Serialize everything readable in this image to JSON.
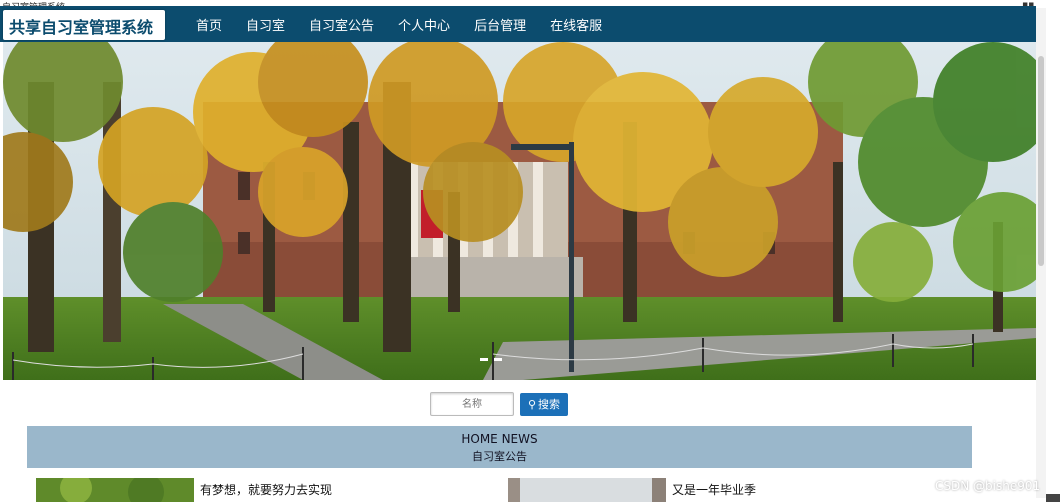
{
  "page_title": "自习室管理系统",
  "logo": "共享自习室管理系统",
  "nav": [
    {
      "label": "首页"
    },
    {
      "label": "自习室"
    },
    {
      "label": "自习室公告"
    },
    {
      "label": "个人中心"
    },
    {
      "label": "后台管理"
    },
    {
      "label": "在线客服"
    }
  ],
  "search": {
    "placeholder": "名称",
    "button_label": "搜索"
  },
  "home_news": {
    "title": "HOME NEWS",
    "subtitle": "自习室公告"
  },
  "news": [
    {
      "title": "有梦想，就要努力去实现"
    },
    {
      "title": "又是一年毕业季"
    }
  ],
  "watermark": "CSDN @bishe901",
  "colors": {
    "navbar": "#0c4c6e",
    "accent": "#1c70b8",
    "section_band": "#9ab7cb"
  }
}
